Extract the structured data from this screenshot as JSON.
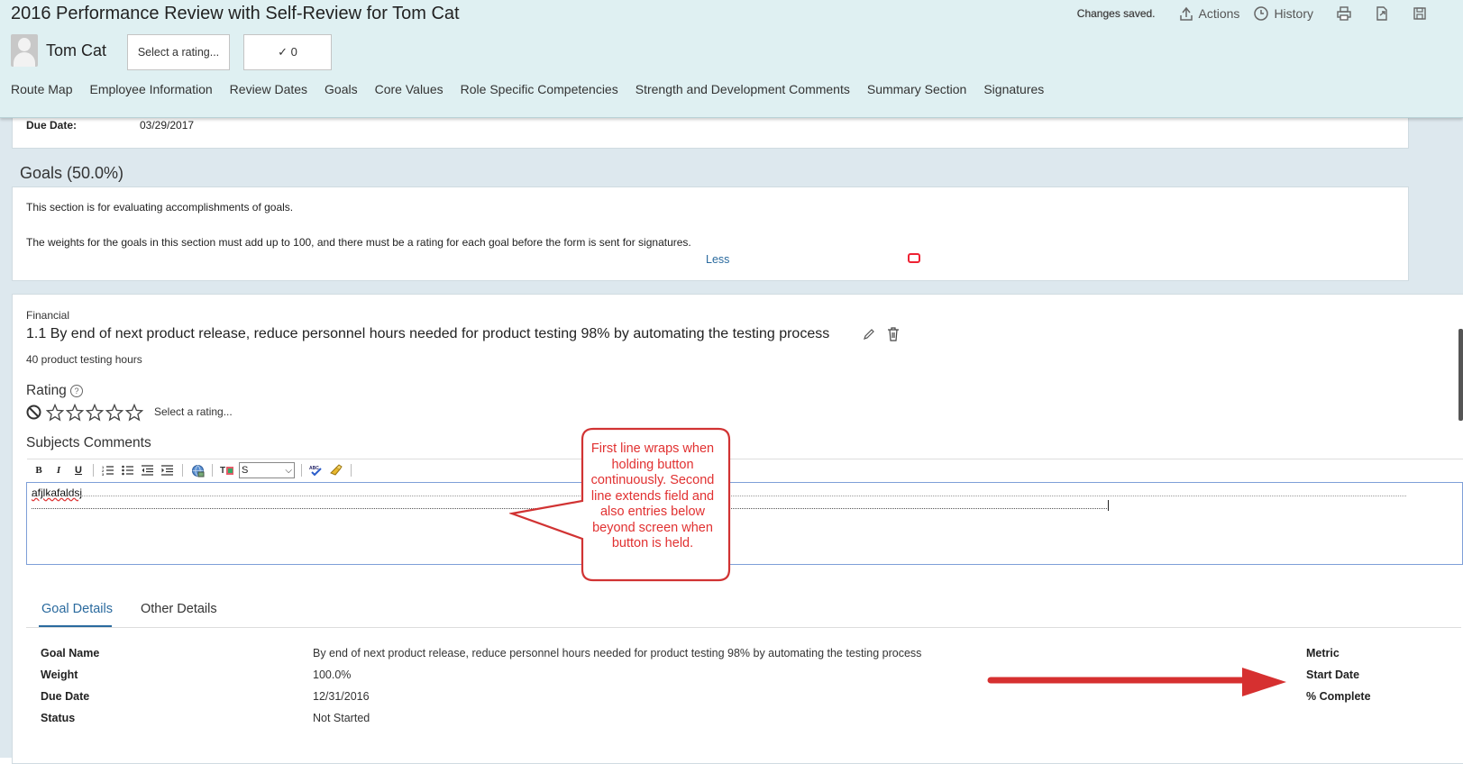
{
  "header": {
    "title": "2016 Performance Review with Self-Review for Tom Cat",
    "status": "Changes saved.",
    "actions_label": "Actions",
    "history_label": "History",
    "employee_name": "Tom Cat",
    "rating_select": "Select a rating...",
    "check_count": "✓ 0"
  },
  "nav": {
    "items": [
      "Route Map",
      "Employee Information",
      "Review Dates",
      "Goals",
      "Core Values",
      "Role Specific Competencies",
      "Strength and Development Comments",
      "Summary Section",
      "Signatures"
    ]
  },
  "review_dates": {
    "due_label": "Due Date:",
    "due_value": "03/29/2017"
  },
  "goals_section": {
    "title": "Goals (50.0%)",
    "intro": "This section is for evaluating accomplishments of goals.",
    "rule": "The weights for the goals in this section must add up to 100, and there must be a rating for each goal before the form is sent for signatures.",
    "less_link": "Less"
  },
  "goal": {
    "category": "Financial",
    "title": "1.1 By end of next product release, reduce personnel hours needed for product testing 98% by automating the testing process",
    "subtitle": "40 product testing hours",
    "rating_label": "Rating",
    "rating_help": "?",
    "rating_value": 0,
    "rating_max": 5,
    "rating_hint": "Select a rating...",
    "comments_label": "Subjects Comments",
    "comment_text": "afjlkafaldsj",
    "font_select": "S"
  },
  "callout": {
    "text": "First line wraps when holding button continuously. Second line extends field and also entries below beyond screen when button is held."
  },
  "tabs": {
    "goal_details": "Goal Details",
    "other_details": "Other Details"
  },
  "details": {
    "rows": [
      {
        "label": "Goal Name",
        "value": "By end of next product release, reduce personnel hours needed for product testing 98% by automating the testing process"
      },
      {
        "label": "Weight",
        "value": "100.0%"
      },
      {
        "label": "Due Date",
        "value": "12/31/2016"
      },
      {
        "label": "Status",
        "value": "Not Started"
      }
    ],
    "right_labels": [
      "Metric",
      "Start Date",
      "% Complete"
    ]
  },
  "colors": {
    "header_bg": "#dff0f2",
    "content_bg": "#dde8ee",
    "link": "#2a6a9e",
    "annotation": "#e13131"
  }
}
